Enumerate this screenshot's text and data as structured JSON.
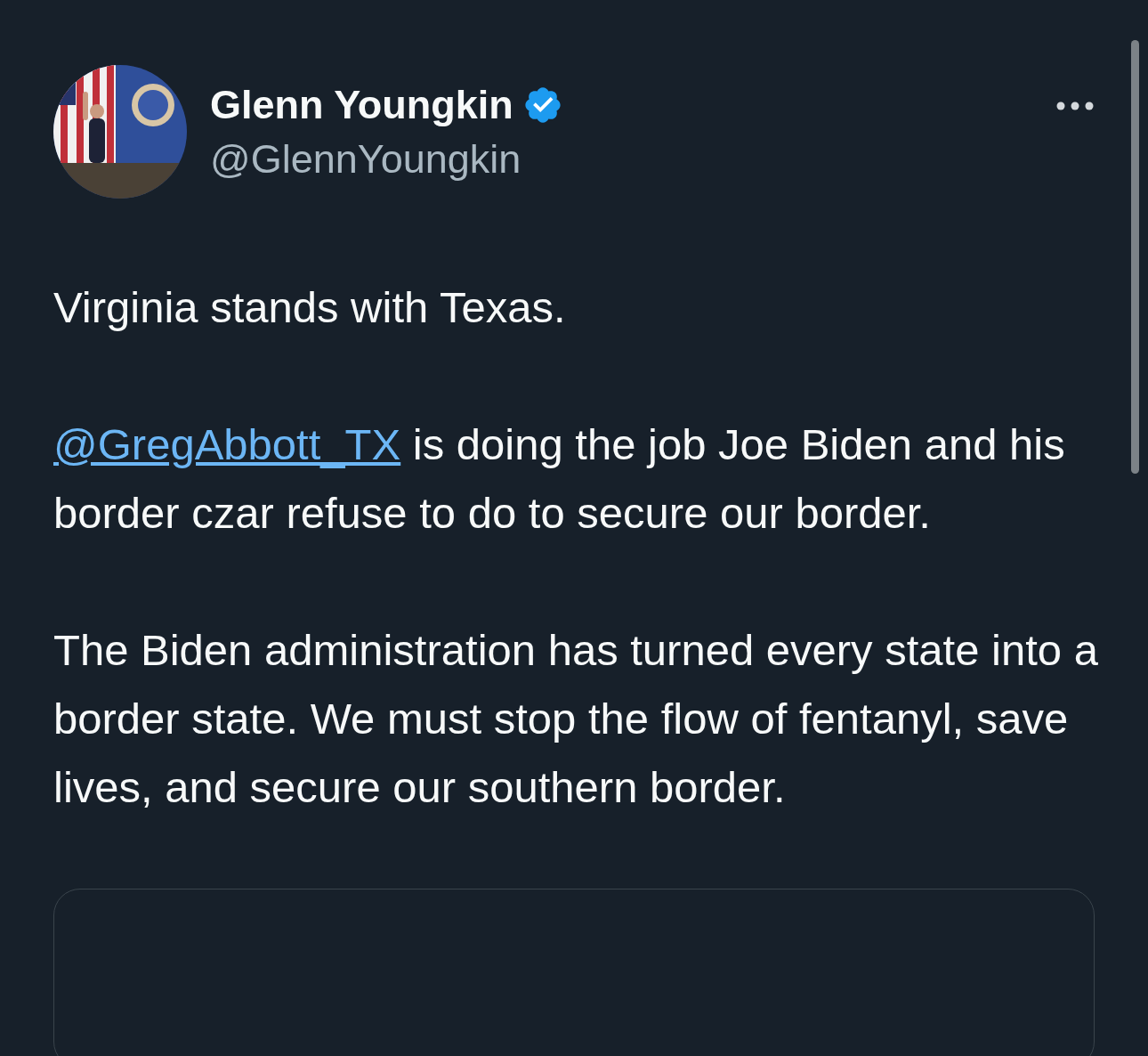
{
  "author": {
    "name": "Glenn Youngkin",
    "handle": "@GlennYoungkin",
    "verified": true
  },
  "paragraphs": [
    [
      {
        "kind": "text",
        "text": "Virginia stands with Texas."
      }
    ],
    [
      {
        "kind": "mention",
        "text": "@GregAbbott_TX"
      },
      {
        "kind": "text",
        "text": " is doing the job Joe Biden and his border czar refuse to do to secure our border."
      }
    ],
    [
      {
        "kind": "text",
        "text": "The Biden administration has turned every state into a border state. We must stop the flow of fentanyl, save lives, and secure our southern border."
      }
    ]
  ]
}
